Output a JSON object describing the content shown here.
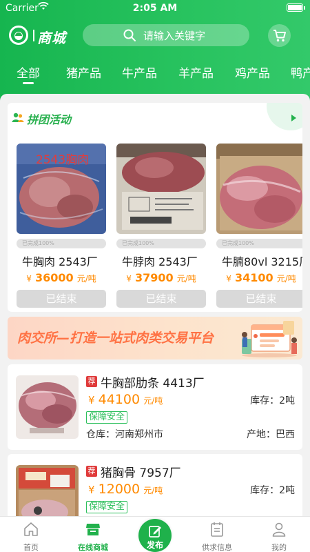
{
  "status_bar": {
    "carrier": "Carrier",
    "time": "2:05 AM"
  },
  "header": {
    "logo_text": "商城",
    "search_placeholder": "请输入关键字"
  },
  "tabs": [
    {
      "label": "全部",
      "active": true
    },
    {
      "label": "猪产品"
    },
    {
      "label": "牛产品"
    },
    {
      "label": "羊产品"
    },
    {
      "label": "鸡产品"
    },
    {
      "label": "鸭产"
    }
  ],
  "group_buy": {
    "title": "拼团活动",
    "items": [
      {
        "name": "牛胸肉 2543厂",
        "image_text": "2543胸肉",
        "progress_label": "已完成100%",
        "progress": 1.0,
        "price_symbol": "¥",
        "price": "36000",
        "unit": "元/吨",
        "button": "已结束"
      },
      {
        "name": "牛脖肉 2543厂",
        "image_text": "",
        "progress_label": "已完成100%",
        "progress": 1.0,
        "price_symbol": "¥",
        "price": "37900",
        "unit": "元/吨",
        "button": "已结束"
      },
      {
        "name": "牛腩80vl 3215厂",
        "image_text": "",
        "progress_label": "已完成100%",
        "progress": 1.0,
        "price_symbol": "¥",
        "price": "34100",
        "unit": "元/吨",
        "button": "已结束"
      }
    ]
  },
  "banner": {
    "text": "肉交所—打造一站式肉类交易平台"
  },
  "products": [
    {
      "badge": "荐",
      "name": "牛胸部肋条 4413厂",
      "price_symbol": "¥",
      "price": "44100",
      "unit": "元/吨",
      "stock": "库存：2吨",
      "tag": "保障安全",
      "warehouse": "仓库：河南郑州市",
      "origin": "产地：巴西"
    },
    {
      "badge": "荐",
      "name": "猪胸骨 7957厂",
      "price_symbol": "¥",
      "price": "12000",
      "unit": "元/吨",
      "stock": "库存：2吨",
      "tag": "保障安全"
    }
  ],
  "bottom_nav": [
    {
      "label": "首页",
      "icon": "home-icon"
    },
    {
      "label": "在线商城",
      "icon": "store-icon",
      "active": true
    },
    {
      "label": "发布",
      "icon": "edit-icon"
    },
    {
      "label": "供求信息",
      "icon": "document-icon"
    },
    {
      "label": "我的",
      "icon": "user-icon"
    }
  ],
  "colors": {
    "brand_green": "#22b14c",
    "price_orange": "#ff8a00",
    "badge_red": "#e03b3b",
    "banner_text": "#ff7244"
  }
}
